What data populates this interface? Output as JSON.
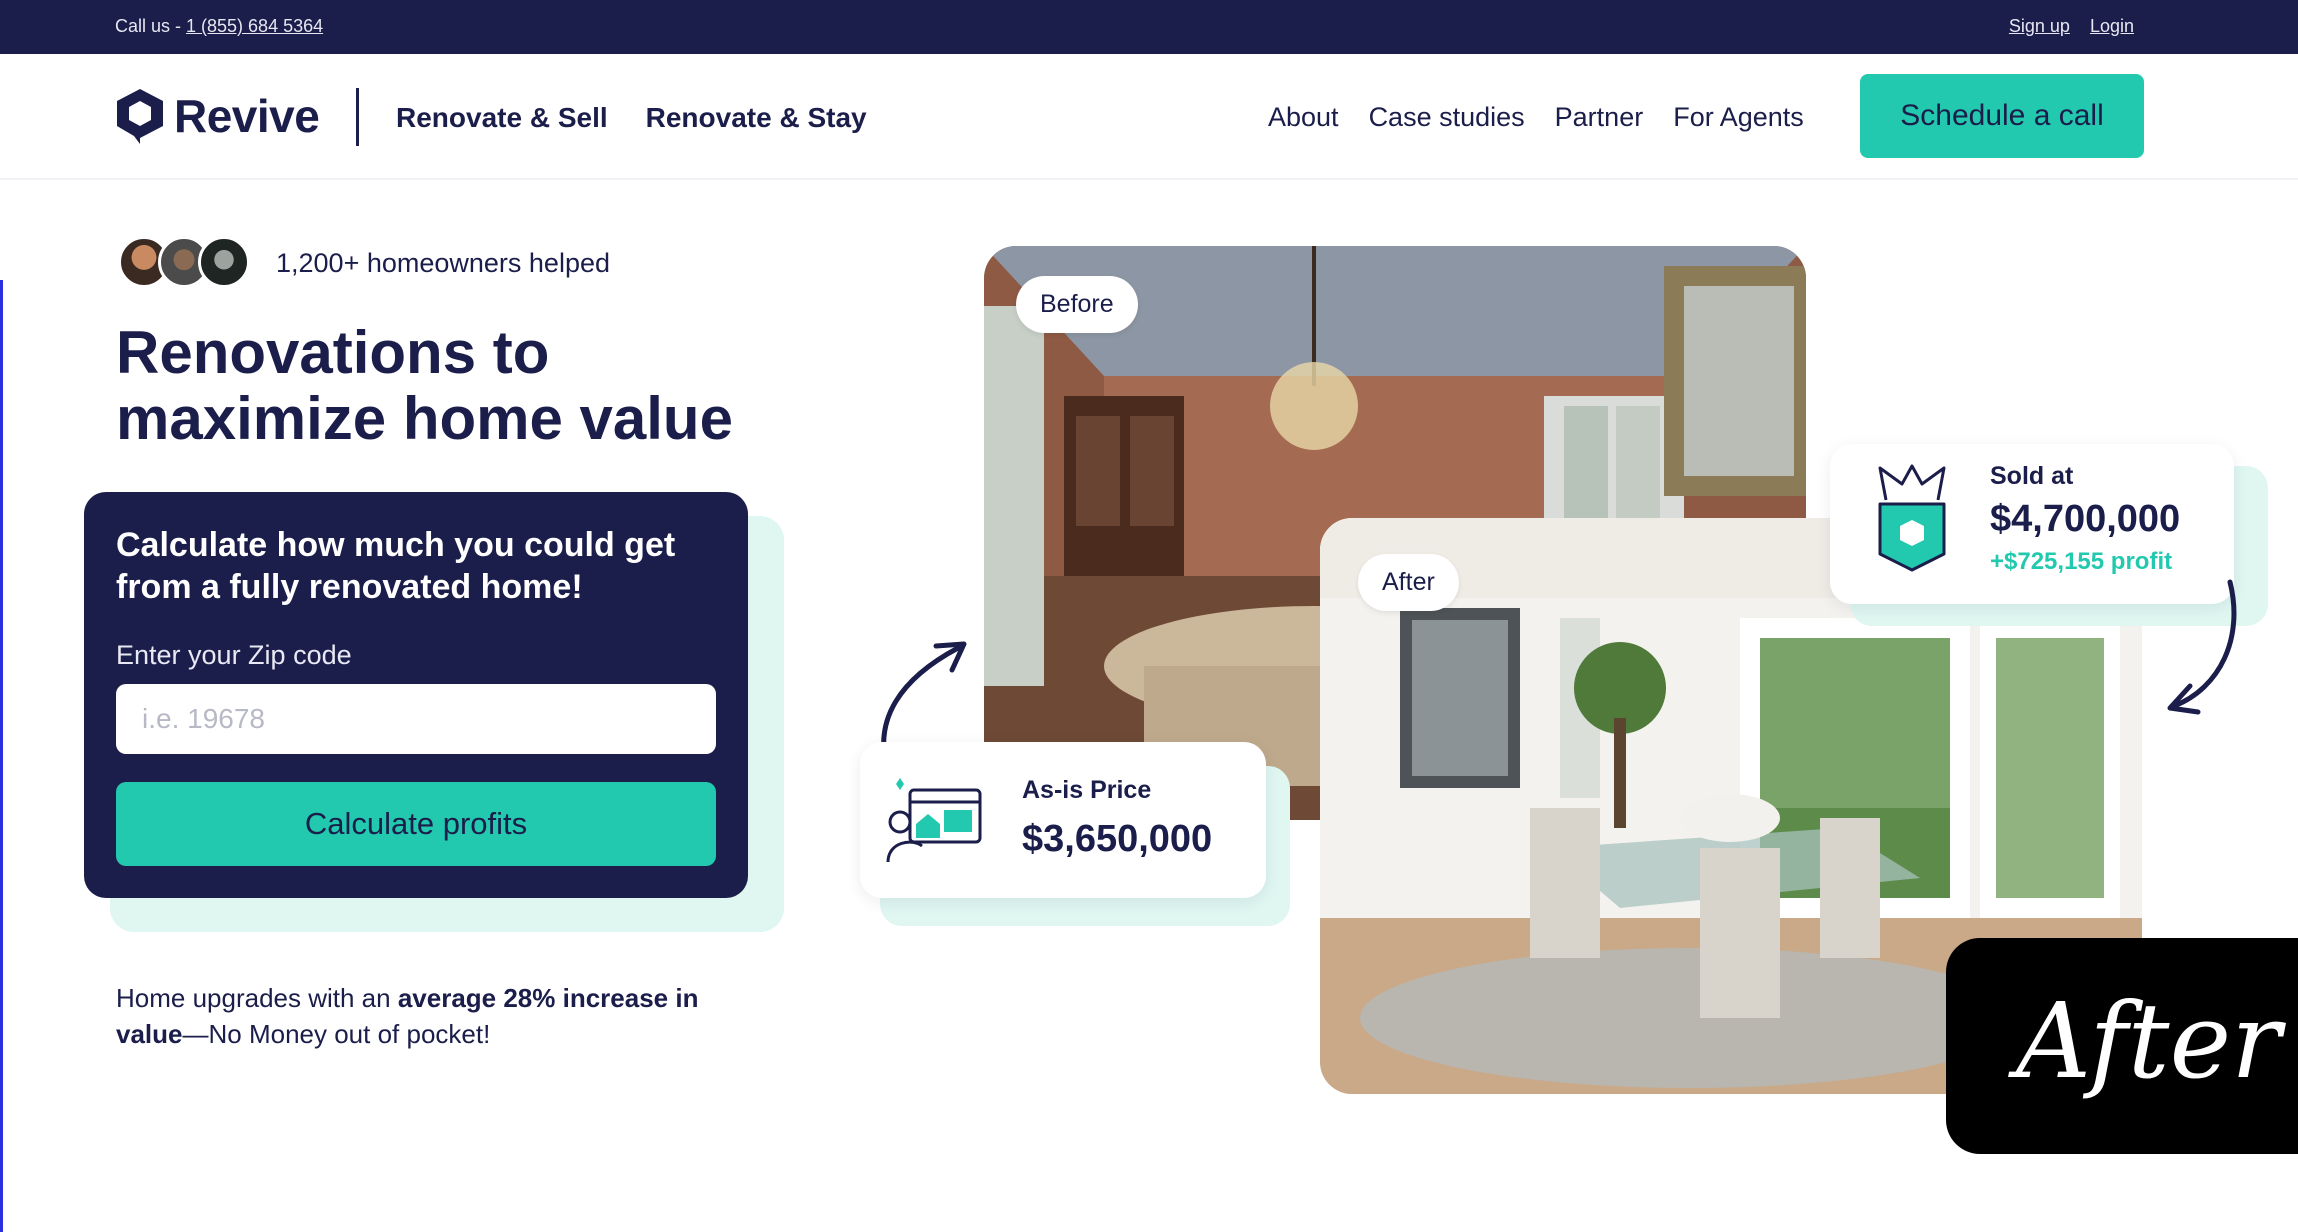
{
  "topbar": {
    "call_prefix": "Call us - ",
    "phone": "1 (855) 684 5364",
    "signup": "Sign up",
    "login": "Login"
  },
  "nav": {
    "logo": "Revive",
    "left_links": [
      "Renovate & Sell",
      "Renovate & Stay"
    ],
    "right_links": [
      "About",
      "Case studies",
      "Partner",
      "For Agents"
    ],
    "cta": "Schedule a call"
  },
  "hero": {
    "helped": "1,200+ homeowners helped",
    "headline": "Renovations to maximize home value",
    "calculator": {
      "title": "Calculate how much you could get from a fully renovated home!",
      "zip_label": "Enter your Zip code",
      "zip_placeholder": "i.e. 19678",
      "zip_value": "",
      "button": "Calculate profits"
    },
    "subtext": {
      "part1": "Home upgrades with an ",
      "bold": "average 28% increase in value",
      "part2": "—No Money out of pocket!"
    }
  },
  "showcase": {
    "before_tag": "Before",
    "after_tag": "After",
    "as_is_label": "As-is Price",
    "as_is_value": "$3,650,000",
    "sold_label": "Sold at",
    "sold_value": "$4,700,000",
    "profit": "+$725,155 profit",
    "overlay_badge": "After"
  },
  "colors": {
    "navy": "#1b1d4a",
    "teal": "#22c9ae",
    "mint": "#dff6f1"
  }
}
